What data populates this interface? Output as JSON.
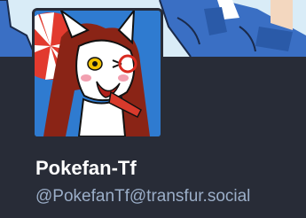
{
  "profile": {
    "display_name": "Pokefan-Tf",
    "handle": "@PokefanTf@transfur.social"
  },
  "avatar": {
    "alt": "Pokefan-Tf avatar"
  },
  "colors": {
    "background": "#282c37",
    "display_name": "#ffffff",
    "handle": "#9baec8",
    "banner_blue": "#3a6fc4",
    "avatar_bg": "#2f7bd0"
  }
}
